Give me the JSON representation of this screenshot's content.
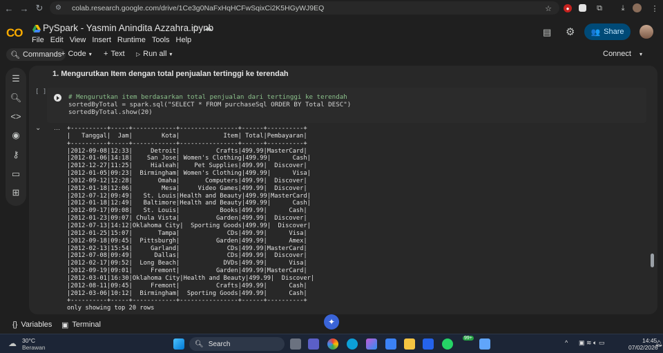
{
  "browser": {
    "url": "colab.research.google.com/drive/1Ce3g0NaFxHqHCFwSqixCi2K5HGyWJ9EQ"
  },
  "header": {
    "logo": "CO",
    "title": "PySpark - Yasmin Anindita Azzahra.ipynb",
    "menu": [
      "File",
      "Edit",
      "View",
      "Insert",
      "Runtime",
      "Tools",
      "Help"
    ],
    "share_label": "Share"
  },
  "toolbar": {
    "commands": "Commands",
    "code": "Code",
    "text": "Text",
    "run_all": "Run all",
    "connect": "Connect"
  },
  "notebook": {
    "heading": "1. Mengurutkan Item dengan total penjualan tertinggi ke terendah",
    "cell_execution": "[ ]",
    "code_lines": [
      "# Mengurutkan item berdasarkan total penjualan dari tertinggi ke terendah",
      "sortedByTotal = spark.sql(\"SELECT * FROM purchaseSql ORDER BY Total DESC\")",
      "sortedByTotal.show(20)"
    ],
    "output": "+----------+-----+------------+----------------+------+----------+\n|   Tanggal|  Jam|        Kota|            Item| Total|Pembayaran|\n+----------+-----+------------+----------------+------+----------+\n|2012-09-08|12:33|     Detroit|          Crafts|499.99|MasterCard|\n|2012-01-06|14:18|    San Jose| Women's Clothing|499.99|      Cash|\n|2012-12-27|11:25|     Hialeah|    Pet Supplies|499.99|  Discover|\n|2012-01-05|09:23|  Birmingham| Women's Clothing|499.99|      Visa|\n|2012-09-12|12:28|       Omaha|       Computers|499.99|  Discover|\n|2012-01-18|12:06|        Mesa|     Video Games|499.99|  Discover|\n|2012-07-12|09:49|   St. Louis|Health and Beauty|499.99|MasterCard|\n|2012-01-18|12:49|   Baltimore|Health and Beauty|499.99|      Cash|\n|2012-09-17|09:08|   St. Louis|           Books|499.99|      Cash|\n|2012-01-23|09:07| Chula Vista|          Garden|499.99|  Discover|\n|2012-07-13|14:12|Oklahoma City|  Sporting Goods|499.99|  Discover|\n|2012-01-25|15:07|       Tampa|             CDs|499.99|      Visa|\n|2012-09-18|09:45|  Pittsburgh|          Garden|499.99|      Amex|\n|2012-02-13|15:54|     Garland|             CDs|499.99|MasterCard|\n|2012-07-08|09:49|      Dallas|             CDs|499.99|  Discover|\n|2012-02-17|09:52|  Long Beach|            DVDs|499.99|      Visa|\n|2012-09-19|09:01|     Fremont|          Garden|499.99|MasterCard|\n|2012-03-01|16:30|Oklahoma City|Health and Beauty|499.99|  Discover|\n|2012-08-11|09:45|     Fremont|          Crafts|499.99|      Cash|\n|2012-03-06|10:12|  Birmingham|  Sporting Goods|499.99|      Cash|\n+----------+-----+------------+----------------+------+----------+\nonly showing top 20 rows"
  },
  "bottom_panel": {
    "variables": "Variables",
    "terminal": "Terminal"
  },
  "taskbar": {
    "weather_temp": "30°C",
    "weather_desc": "Berawan",
    "search": "Search",
    "badge": "99+",
    "time": "14:45",
    "date": "07/02/2026"
  }
}
